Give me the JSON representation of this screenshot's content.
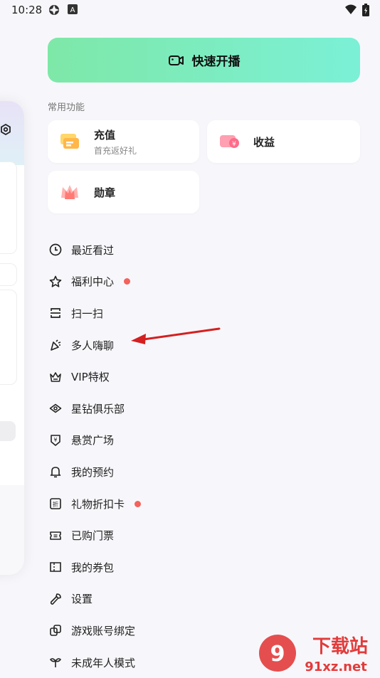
{
  "status_bar": {
    "time": "10:28"
  },
  "quick_start": {
    "label": "快速开播"
  },
  "section": {
    "title": "常用功能"
  },
  "features": [
    {
      "title": "充值",
      "subtitle": "首充返好礼"
    },
    {
      "title": "收益"
    },
    {
      "title": "勋章"
    }
  ],
  "menu": [
    {
      "label": "最近看过",
      "icon": "clock-icon",
      "badge": false
    },
    {
      "label": "福利中心",
      "icon": "star-icon",
      "badge": true
    },
    {
      "label": "扫一扫",
      "icon": "scan-icon",
      "badge": false
    },
    {
      "label": "多人嗨聊",
      "icon": "party-icon",
      "badge": false
    },
    {
      "label": "VIP特权",
      "icon": "crown-icon",
      "badge": false
    },
    {
      "label": "星钻俱乐部",
      "icon": "diamond-icon",
      "badge": false
    },
    {
      "label": "悬赏广场",
      "icon": "bounty-icon",
      "badge": false
    },
    {
      "label": "我的预约",
      "icon": "bell-icon",
      "badge": false
    },
    {
      "label": "礼物折扣卡",
      "icon": "discount-icon",
      "badge": true
    },
    {
      "label": "已购门票",
      "icon": "ticket-icon",
      "badge": false
    },
    {
      "label": "我的券包",
      "icon": "coupon-icon",
      "badge": false
    },
    {
      "label": "设置",
      "icon": "wrench-icon",
      "badge": false
    },
    {
      "label": "游戏账号绑定",
      "icon": "link-icon",
      "badge": false
    },
    {
      "label": "未成年人模式",
      "icon": "sprout-icon",
      "badge": false
    }
  ],
  "watermark": {
    "text": "下载站",
    "url": "91xz.net"
  },
  "colors": {
    "accent_start": "#7ee8a8",
    "accent_end": "#7bf0d6",
    "badge": "#f5615b",
    "arrow": "#d42020"
  }
}
